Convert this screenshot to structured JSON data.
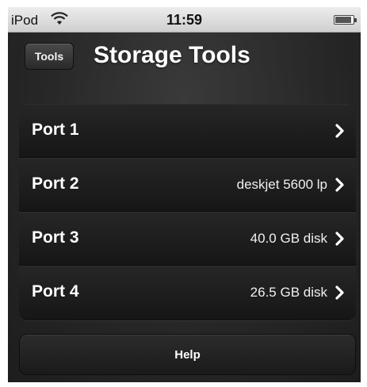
{
  "status_bar": {
    "carrier": "iPod",
    "time": "11:59",
    "wifi_icon": "wifi-icon",
    "battery_icon": "battery-icon"
  },
  "nav": {
    "back_label": "Tools",
    "title": "Storage Tools"
  },
  "ports": [
    {
      "label": "Port 1",
      "detail": ""
    },
    {
      "label": "Port 2",
      "detail": "deskjet 5600 lp"
    },
    {
      "label": "Port 3",
      "detail": "40.0 GB disk"
    },
    {
      "label": "Port 4",
      "detail": "26.5 GB disk"
    }
  ],
  "help": {
    "label": "Help"
  },
  "colors": {
    "background": "#262626",
    "text": "#ffffff"
  }
}
